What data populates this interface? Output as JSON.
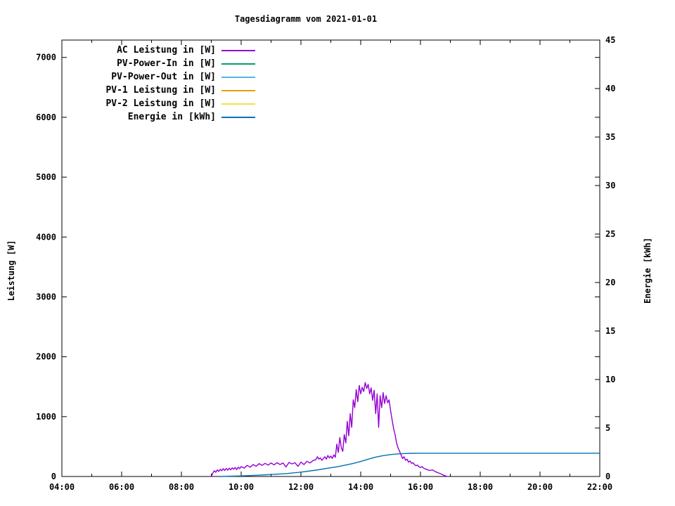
{
  "title": "Tagesdiagramm vom 2021-01-01",
  "chart_data": {
    "type": "line",
    "title": "Tagesdiagramm vom 2021-01-01",
    "grid": false,
    "legend_position": "top-left-inside",
    "x_axis": {
      "label": "",
      "range": [
        4,
        22
      ],
      "major_ticks": [
        {
          "h": 4,
          "label": "04:00"
        },
        {
          "h": 6,
          "label": "06:00"
        },
        {
          "h": 8,
          "label": "08:00"
        },
        {
          "h": 10,
          "label": "10:00"
        },
        {
          "h": 12,
          "label": "12:00"
        },
        {
          "h": 14,
          "label": "14:00"
        },
        {
          "h": 16,
          "label": "16:00"
        },
        {
          "h": 18,
          "label": "18:00"
        },
        {
          "h": 20,
          "label": "20:00"
        },
        {
          "h": 22,
          "label": "22:00"
        }
      ],
      "minor_ticks": [
        5,
        7,
        9,
        11,
        13,
        15,
        17,
        19,
        21
      ]
    },
    "y1_axis": {
      "label": "Leistung [W]",
      "range": [
        0,
        7290
      ],
      "ticks": [
        0,
        1000,
        2000,
        3000,
        4000,
        5000,
        6000,
        7000
      ]
    },
    "y2_axis": {
      "label": "Energie [kWh]",
      "range": [
        0,
        45
      ],
      "ticks": [
        0,
        5,
        10,
        15,
        20,
        25,
        30,
        35,
        40,
        45
      ]
    },
    "series": [
      {
        "id": "ac-leistung",
        "label": "AC Leistung in [W]",
        "color": "#9400d3",
        "axis": "y1",
        "visible": true,
        "points": [
          [
            9.0,
            0
          ],
          [
            9.05,
            55
          ],
          [
            9.1,
            95
          ],
          [
            9.15,
            70
          ],
          [
            9.2,
            110
          ],
          [
            9.25,
            85
          ],
          [
            9.3,
            120
          ],
          [
            9.35,
            95
          ],
          [
            9.4,
            130
          ],
          [
            9.45,
            100
          ],
          [
            9.5,
            135
          ],
          [
            9.55,
            105
          ],
          [
            9.6,
            140
          ],
          [
            9.65,
            110
          ],
          [
            9.7,
            145
          ],
          [
            9.75,
            120
          ],
          [
            9.8,
            150
          ],
          [
            9.85,
            115
          ],
          [
            9.9,
            155
          ],
          [
            9.95,
            130
          ],
          [
            10.0,
            165
          ],
          [
            10.1,
            140
          ],
          [
            10.2,
            185
          ],
          [
            10.3,
            155
          ],
          [
            10.4,
            200
          ],
          [
            10.5,
            170
          ],
          [
            10.6,
            215
          ],
          [
            10.7,
            185
          ],
          [
            10.8,
            220
          ],
          [
            10.9,
            190
          ],
          [
            11.0,
            225
          ],
          [
            11.1,
            195
          ],
          [
            11.2,
            230
          ],
          [
            11.3,
            200
          ],
          [
            11.4,
            225
          ],
          [
            11.5,
            160
          ],
          [
            11.6,
            235
          ],
          [
            11.7,
            210
          ],
          [
            11.8,
            230
          ],
          [
            11.9,
            170
          ],
          [
            12.0,
            240
          ],
          [
            12.1,
            200
          ],
          [
            12.2,
            255
          ],
          [
            12.3,
            225
          ],
          [
            12.4,
            265
          ],
          [
            12.5,
            280
          ],
          [
            12.55,
            330
          ],
          [
            12.6,
            290
          ],
          [
            12.65,
            310
          ],
          [
            12.7,
            270
          ],
          [
            12.75,
            300
          ],
          [
            12.8,
            330
          ],
          [
            12.85,
            290
          ],
          [
            12.9,
            350
          ],
          [
            12.95,
            310
          ],
          [
            13.0,
            340
          ],
          [
            13.05,
            300
          ],
          [
            13.1,
            360
          ],
          [
            13.15,
            320
          ],
          [
            13.2,
            540
          ],
          [
            13.25,
            400
          ],
          [
            13.3,
            650
          ],
          [
            13.35,
            480
          ],
          [
            13.4,
            420
          ],
          [
            13.45,
            700
          ],
          [
            13.5,
            560
          ],
          [
            13.55,
            920
          ],
          [
            13.6,
            680
          ],
          [
            13.65,
            1050
          ],
          [
            13.7,
            820
          ],
          [
            13.75,
            1280
          ],
          [
            13.8,
            1150
          ],
          [
            13.85,
            1450
          ],
          [
            13.9,
            1250
          ],
          [
            13.95,
            1520
          ],
          [
            14.0,
            1380
          ],
          [
            14.05,
            1490
          ],
          [
            14.1,
            1420
          ],
          [
            14.15,
            1570
          ],
          [
            14.2,
            1470
          ],
          [
            14.25,
            1540
          ],
          [
            14.3,
            1380
          ],
          [
            14.35,
            1480
          ],
          [
            14.4,
            1270
          ],
          [
            14.45,
            1440
          ],
          [
            14.5,
            1050
          ],
          [
            14.55,
            1380
          ],
          [
            14.6,
            820
          ],
          [
            14.65,
            1350
          ],
          [
            14.7,
            1150
          ],
          [
            14.75,
            1400
          ],
          [
            14.8,
            1220
          ],
          [
            14.85,
            1350
          ],
          [
            14.9,
            1230
          ],
          [
            14.95,
            1280
          ],
          [
            15.0,
            1100
          ],
          [
            15.05,
            950
          ],
          [
            15.1,
            800
          ],
          [
            15.15,
            700
          ],
          [
            15.2,
            560
          ],
          [
            15.25,
            480
          ],
          [
            15.3,
            420
          ],
          [
            15.35,
            360
          ],
          [
            15.4,
            300
          ],
          [
            15.45,
            330
          ],
          [
            15.5,
            270
          ],
          [
            15.55,
            290
          ],
          [
            15.6,
            240
          ],
          [
            15.65,
            260
          ],
          [
            15.7,
            220
          ],
          [
            15.75,
            230
          ],
          [
            15.8,
            200
          ],
          [
            15.85,
            180
          ],
          [
            15.9,
            190
          ],
          [
            15.95,
            160
          ],
          [
            16.0,
            150
          ],
          [
            16.05,
            165
          ],
          [
            16.1,
            140
          ],
          [
            16.2,
            120
          ],
          [
            16.3,
            100
          ],
          [
            16.4,
            110
          ],
          [
            16.5,
            80
          ],
          [
            16.6,
            60
          ],
          [
            16.7,
            40
          ],
          [
            16.8,
            15
          ],
          [
            16.9,
            0
          ]
        ]
      },
      {
        "id": "pv-power-in",
        "label": "PV-Power-In in [W]",
        "color": "#009e73",
        "axis": "y1",
        "visible": false,
        "points": []
      },
      {
        "id": "pv-power-out",
        "label": "PV-Power-Out in [W]",
        "color": "#56b4e9",
        "axis": "y1",
        "visible": false,
        "points": []
      },
      {
        "id": "pv1-leistung",
        "label": "PV-1 Leistung in [W]",
        "color": "#e69f00",
        "axis": "y1",
        "visible": false,
        "points": []
      },
      {
        "id": "pv2-leistung",
        "label": "PV-2 Leistung in [W]",
        "color": "#f0e442",
        "axis": "y1",
        "visible": false,
        "points": []
      },
      {
        "id": "energie",
        "label": "Energie in [kWh]",
        "color": "#0072b2",
        "axis": "y2",
        "visible": true,
        "points": [
          [
            9.3,
            0
          ],
          [
            9.5,
            0.02
          ],
          [
            10.0,
            0.06
          ],
          [
            10.5,
            0.12
          ],
          [
            11.0,
            0.2
          ],
          [
            11.5,
            0.3
          ],
          [
            12.0,
            0.45
          ],
          [
            12.5,
            0.65
          ],
          [
            13.0,
            0.9
          ],
          [
            13.25,
            1.02
          ],
          [
            13.5,
            1.18
          ],
          [
            13.75,
            1.35
          ],
          [
            14.0,
            1.55
          ],
          [
            14.25,
            1.78
          ],
          [
            14.5,
            2.0
          ],
          [
            14.75,
            2.15
          ],
          [
            15.0,
            2.26
          ],
          [
            15.25,
            2.33
          ],
          [
            15.5,
            2.37
          ],
          [
            15.75,
            2.39
          ],
          [
            16.0,
            2.4
          ],
          [
            22.0,
            2.4
          ]
        ]
      }
    ]
  }
}
